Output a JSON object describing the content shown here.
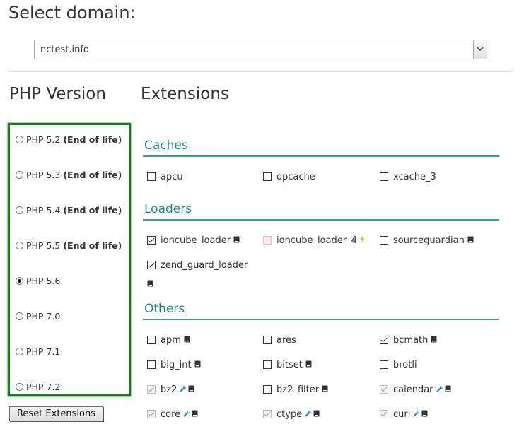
{
  "header": {
    "title": "Select domain:"
  },
  "domain_select": {
    "value": "nctest.info"
  },
  "php": {
    "heading": "PHP Version",
    "options": [
      {
        "label": "PHP 5.2",
        "note": "(End of life)",
        "selected": false
      },
      {
        "label": "PHP 5.3",
        "note": "(End of life)",
        "selected": false
      },
      {
        "label": "PHP 5.4",
        "note": "(End of life)",
        "selected": false
      },
      {
        "label": "PHP 5.5",
        "note": "(End of life)",
        "selected": false
      },
      {
        "label": "PHP 5.6",
        "note": "",
        "selected": true
      },
      {
        "label": "PHP 7.0",
        "note": "",
        "selected": false
      },
      {
        "label": "PHP 7.1",
        "note": "",
        "selected": false
      },
      {
        "label": "PHP 7.2",
        "note": "",
        "selected": false
      }
    ],
    "reset_label": "Reset Extensions",
    "highlight_color": "#1c7b1c"
  },
  "extensions": {
    "heading": "Extensions",
    "accent_color": "#1b8a8a",
    "sections": [
      {
        "title": "Caches",
        "items": [
          {
            "name": "apcu",
            "checked": false,
            "state": "normal",
            "icons": []
          },
          {
            "name": "opcache",
            "checked": false,
            "state": "normal",
            "icons": []
          },
          {
            "name": "xcache_3",
            "checked": false,
            "state": "normal",
            "icons": []
          }
        ]
      },
      {
        "title": "Loaders",
        "items": [
          {
            "name": "ioncube_loader",
            "checked": true,
            "state": "normal",
            "icons": [
              "book-icon"
            ]
          },
          {
            "name": "ioncube_loader_4",
            "checked": false,
            "state": "conflict",
            "icons": [
              "lightning-icon"
            ]
          },
          {
            "name": "sourceguardian",
            "checked": false,
            "state": "normal",
            "icons": [
              "book-icon"
            ]
          },
          {
            "name": "zend_guard_loader",
            "checked": true,
            "state": "normal",
            "icons": [
              "book-icon"
            ]
          }
        ]
      },
      {
        "title": "Others",
        "items": [
          {
            "name": "apm",
            "checked": false,
            "state": "normal",
            "icons": [
              "book-icon"
            ]
          },
          {
            "name": "ares",
            "checked": false,
            "state": "normal",
            "icons": []
          },
          {
            "name": "bcmath",
            "checked": true,
            "state": "normal",
            "icons": [
              "book-icon"
            ]
          },
          {
            "name": "big_int",
            "checked": false,
            "state": "normal",
            "icons": [
              "book-icon"
            ]
          },
          {
            "name": "bitset",
            "checked": false,
            "state": "normal",
            "icons": [
              "book-icon"
            ]
          },
          {
            "name": "brotli",
            "checked": false,
            "state": "normal",
            "icons": []
          },
          {
            "name": "bz2",
            "checked": true,
            "state": "disabled",
            "icons": [
              "wrench-icon",
              "book-icon"
            ]
          },
          {
            "name": "bz2_filter",
            "checked": false,
            "state": "normal",
            "icons": [
              "book-icon"
            ]
          },
          {
            "name": "calendar",
            "checked": true,
            "state": "disabled",
            "icons": [
              "wrench-icon",
              "book-icon"
            ]
          },
          {
            "name": "core",
            "checked": true,
            "state": "disabled",
            "icons": [
              "wrench-icon",
              "book-icon"
            ]
          },
          {
            "name": "ctype",
            "checked": true,
            "state": "disabled",
            "icons": [
              "wrench-icon",
              "book-icon"
            ]
          },
          {
            "name": "curl",
            "checked": true,
            "state": "disabled",
            "icons": [
              "wrench-icon",
              "book-icon"
            ]
          }
        ]
      }
    ]
  }
}
